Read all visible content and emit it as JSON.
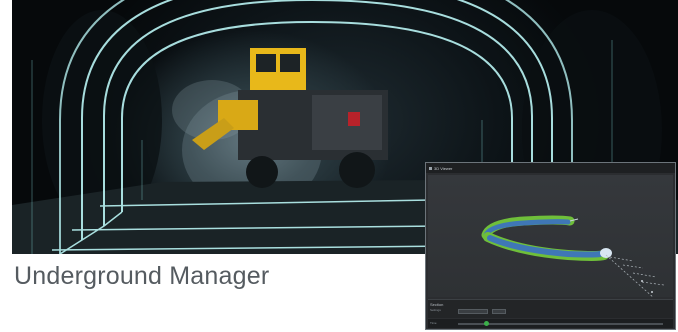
{
  "title": "Underground Manager",
  "app_window": {
    "window_title": "3D Viewer",
    "panel": {
      "section_label": "Section",
      "sub_label": "Settings"
    },
    "timeline": {
      "label": "Time",
      "progress": 0.14
    }
  },
  "colors": {
    "title_text": "#555b60",
    "tunnel_wireframe": "#b9f4f4",
    "machine_yellow": "#e8b81a",
    "tunnel_model_blue": "#3a6fc4",
    "tunnel_model_green": "#6fbf3a",
    "timeline_thumb": "#3cb04a"
  },
  "icons": {
    "window_icon": "app-window-icon"
  }
}
